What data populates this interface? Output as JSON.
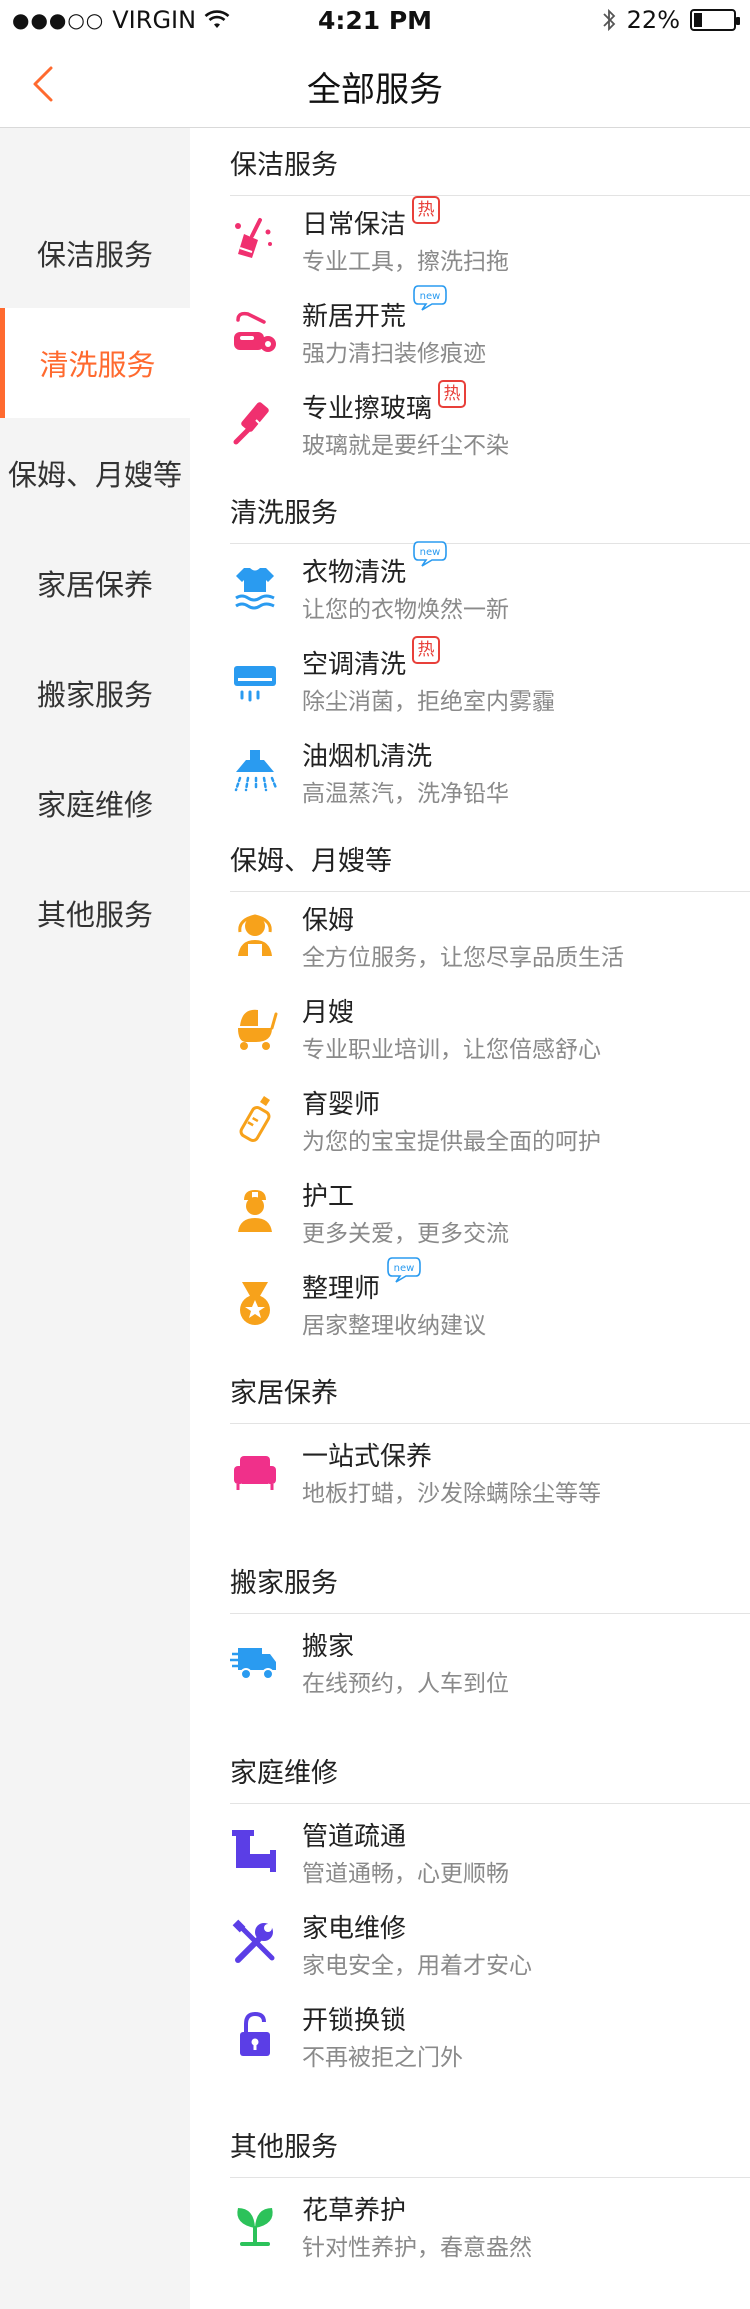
{
  "status_bar": {
    "signal": "●●●○○",
    "carrier": "VIRGIN",
    "time": "4:21 PM",
    "battery_text": "22%",
    "battery_level": 0.22
  },
  "nav": {
    "title": "全部服务"
  },
  "sidebar": {
    "items": [
      {
        "label": "保洁服务",
        "active": false
      },
      {
        "label": "清洗服务",
        "active": true
      },
      {
        "label": "保姆、月嫂等",
        "active": false
      },
      {
        "label": "家居保养",
        "active": false
      },
      {
        "label": "搬家服务",
        "active": false
      },
      {
        "label": "家庭维修",
        "active": false
      },
      {
        "label": "其他服务",
        "active": false
      }
    ]
  },
  "badges": {
    "hot": "热",
    "new": "new"
  },
  "sections": [
    {
      "title": "保洁服务",
      "items": [
        {
          "name": "日常保洁",
          "desc": "专业工具，擦洗扫拖",
          "icon": "broom-icon",
          "color": "#f0306f",
          "badge": "hot"
        },
        {
          "name": "新居开荒",
          "desc": "强力清扫装修痕迹",
          "icon": "vacuum-icon",
          "color": "#f0306f",
          "badge": "new"
        },
        {
          "name": "专业擦玻璃",
          "desc": "玻璃就是要纤尘不染",
          "icon": "squeegee-icon",
          "color": "#f0306f",
          "badge": "hot"
        }
      ]
    },
    {
      "title": "清洗服务",
      "items": [
        {
          "name": "衣物清洗",
          "desc": "让您的衣物焕然一新",
          "icon": "laundry-icon",
          "color": "#2a9bf0",
          "badge": "new"
        },
        {
          "name": "空调清洗",
          "desc": "除尘消菌，拒绝室内雾霾",
          "icon": "air-conditioner-icon",
          "color": "#2a9bf0",
          "badge": "hot"
        },
        {
          "name": "油烟机清洗",
          "desc": "高温蒸汽，洗净铅华",
          "icon": "range-hood-icon",
          "color": "#2a9bf0",
          "badge": ""
        }
      ]
    },
    {
      "title": "保姆、月嫂等",
      "items": [
        {
          "name": "保姆",
          "desc": "全方位服务，让您尽享品质生活",
          "icon": "nanny-icon",
          "color": "#f7a21b",
          "badge": ""
        },
        {
          "name": "月嫂",
          "desc": "专业职业培训，让您倍感舒心",
          "icon": "stroller-icon",
          "color": "#f7a21b",
          "badge": ""
        },
        {
          "name": "育婴师",
          "desc": "为您的宝宝提供最全面的呵护",
          "icon": "baby-bottle-icon",
          "color": "#f7a21b",
          "badge": ""
        },
        {
          "name": "护工",
          "desc": "更多关爱，更多交流",
          "icon": "nurse-icon",
          "color": "#f7a21b",
          "badge": ""
        },
        {
          "name": "整理师",
          "desc": "居家整理收纳建议",
          "icon": "medal-icon",
          "color": "#f7a21b",
          "badge": "new"
        }
      ]
    },
    {
      "title": "家居保养",
      "items": [
        {
          "name": "一站式保养",
          "desc": "地板打蜡，沙发除螨除尘等等",
          "icon": "sofa-icon",
          "color": "#f0308a",
          "badge": ""
        }
      ]
    },
    {
      "title": "搬家服务",
      "items": [
        {
          "name": "搬家",
          "desc": "在线预约，人车到位",
          "icon": "truck-icon",
          "color": "#2a9bf0",
          "badge": ""
        }
      ]
    },
    {
      "title": "家庭维修",
      "items": [
        {
          "name": "管道疏通",
          "desc": "管道通畅，心更顺畅",
          "icon": "pipe-icon",
          "color": "#5b3ee6",
          "badge": ""
        },
        {
          "name": "家电维修",
          "desc": "家电安全，用着才安心",
          "icon": "tools-icon",
          "color": "#5b3ee6",
          "badge": ""
        },
        {
          "name": "开锁换锁",
          "desc": "不再被拒之门外",
          "icon": "unlock-icon",
          "color": "#5b3ee6",
          "badge": ""
        }
      ]
    },
    {
      "title": "其他服务",
      "items": [
        {
          "name": "花草养护",
          "desc": "针对性养护，春意盎然",
          "icon": "plant-icon",
          "color": "#2cc25a",
          "badge": ""
        }
      ]
    }
  ]
}
